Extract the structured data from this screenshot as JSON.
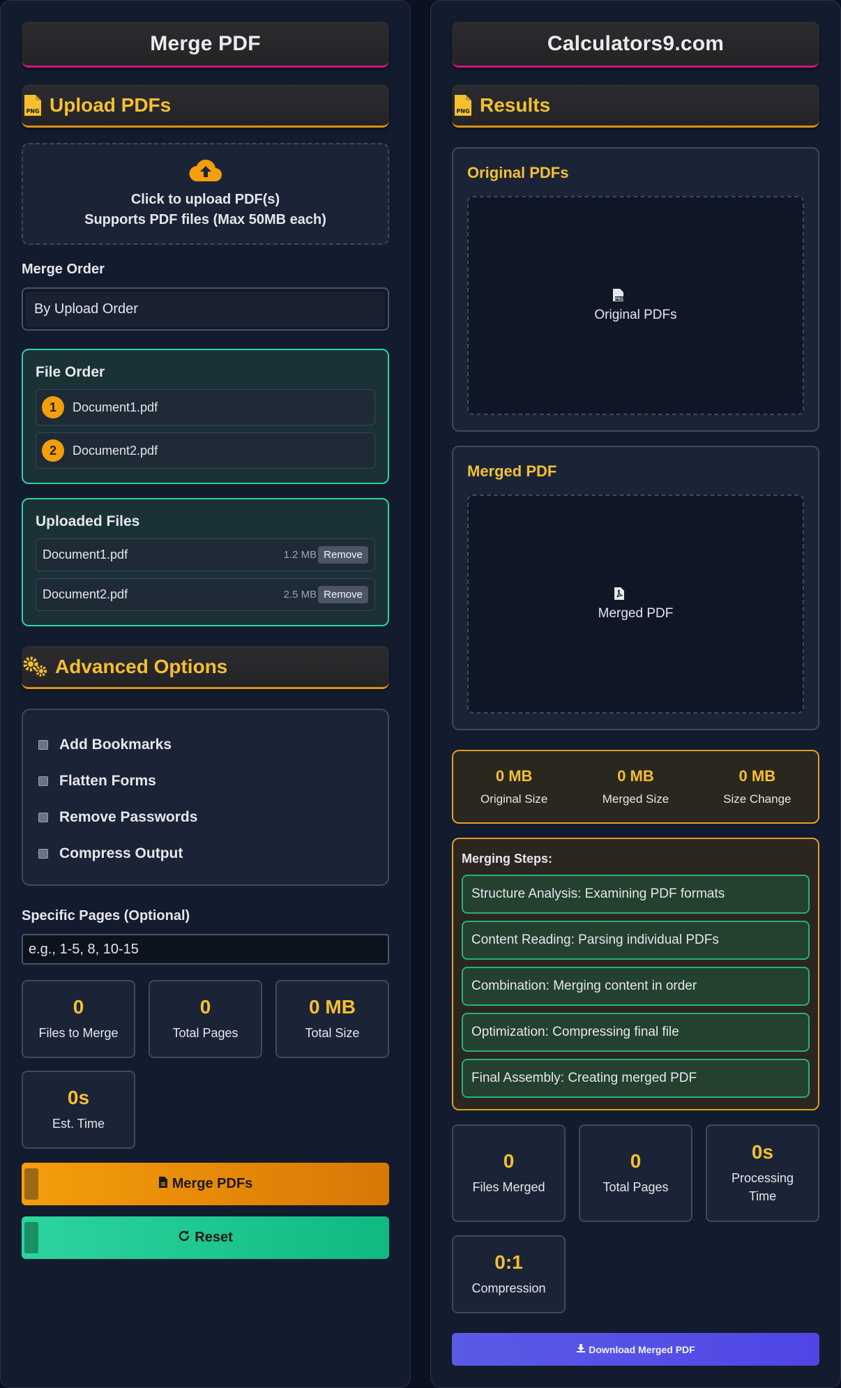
{
  "left": {
    "title": "Merge PDF",
    "upload_heading": "Upload PDFs",
    "upload_line1": "Click to upload PDF(s)",
    "upload_line2": "Supports PDF files (Max 50MB each)",
    "merge_order_label": "Merge Order",
    "merge_order_value": "By Upload Order",
    "file_order": {
      "title": "File Order",
      "items": [
        {
          "num": "1",
          "name": "Document1.pdf"
        },
        {
          "num": "2",
          "name": "Document2.pdf"
        }
      ]
    },
    "uploaded": {
      "title": "Uploaded Files",
      "items": [
        {
          "name": "Document1.pdf",
          "size": "1.2 MB",
          "remove": "Remove"
        },
        {
          "name": "Document2.pdf",
          "size": "2.5 MB",
          "remove": "Remove"
        }
      ]
    },
    "advanced_heading": "Advanced Options",
    "options": [
      "Add Bookmarks",
      "Flatten Forms",
      "Remove Passwords",
      "Compress Output"
    ],
    "pages_label": "Specific Pages (Optional)",
    "pages_placeholder": "e.g., 1-5, 8, 10-15",
    "stats": [
      {
        "value": "0",
        "label": "Files to Merge"
      },
      {
        "value": "0",
        "label": "Total Pages"
      },
      {
        "value": "0 MB",
        "label": "Total Size"
      },
      {
        "value": "0s",
        "label": "Est. Time"
      }
    ],
    "merge_button": "Merge PDFs",
    "reset_button": "Reset"
  },
  "right": {
    "title": "Calculators9.com",
    "results_heading": "Results",
    "original_title": "Original PDFs",
    "original_preview": "Original PDFs",
    "merged_title": "Merged PDF",
    "merged_preview": "Merged PDF",
    "sizes": [
      {
        "value": "0 MB",
        "label": "Original Size"
      },
      {
        "value": "0 MB",
        "label": "Merged Size"
      },
      {
        "value": "0 MB",
        "label": "Size Change"
      }
    ],
    "steps_title": "Merging Steps:",
    "steps": [
      "Structure Analysis: Examining PDF formats",
      "Content Reading: Parsing individual PDFs",
      "Combination: Merging content in order",
      "Optimization: Compressing final file",
      "Final Assembly: Creating merged PDF"
    ],
    "stats": [
      {
        "value": "0",
        "label": "Files Merged"
      },
      {
        "value": "0",
        "label": "Total Pages"
      },
      {
        "value": "0s",
        "label": "Processing Time"
      },
      {
        "value": "0:1",
        "label": "Compression"
      }
    ],
    "download_button": "Download Merged PDF"
  },
  "colors": {
    "accent_yellow": "#f5c030",
    "accent_green": "#2dd4a0",
    "accent_orange": "#f59e0b",
    "indigo": "#4f46e5"
  }
}
